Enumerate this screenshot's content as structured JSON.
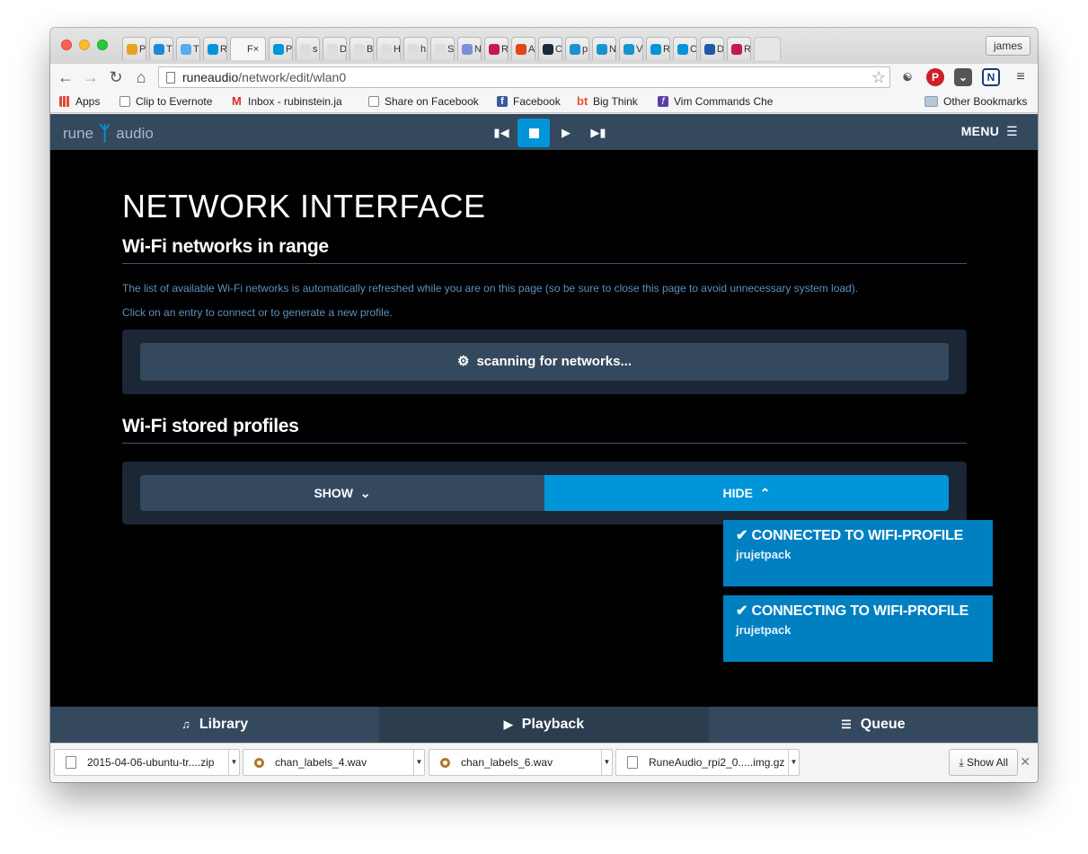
{
  "browser": {
    "profile_name": "james",
    "url_domain": "runeaudio",
    "url_path": "/network/edit/wlan0",
    "tabs": [
      {
        "label": "P",
        "icon": "yellow-face-icon",
        "color": "#e8a31e"
      },
      {
        "label": "T",
        "icon": "blue-play-icon",
        "color": "#1c8adb"
      },
      {
        "label": "T",
        "icon": "twitter-icon",
        "color": "#55acee"
      },
      {
        "label": "R",
        "icon": "rune-icon",
        "color": "#0095d8"
      },
      {
        "label": "F",
        "icon": "page-icon",
        "color": "#f6f6f6",
        "active": true
      },
      {
        "label": "P",
        "icon": "rune-icon",
        "color": "#0095d8"
      },
      {
        "label": "s",
        "icon": "page-icon",
        "color": "#dddddd"
      },
      {
        "label": "D",
        "icon": "page-icon",
        "color": "#dddddd"
      },
      {
        "label": "B",
        "icon": "page-icon",
        "color": "#dddddd"
      },
      {
        "label": "H",
        "icon": "page-icon",
        "color": "#dddddd"
      },
      {
        "label": "h",
        "icon": "page-icon",
        "color": "#dddddd"
      },
      {
        "label": "S",
        "icon": "page-icon",
        "color": "#dddddd"
      },
      {
        "label": "N",
        "icon": "target-icon",
        "color": "#7a8fd6"
      },
      {
        "label": "R",
        "icon": "raspberry-icon",
        "color": "#c51a4a"
      },
      {
        "label": "A",
        "icon": "ubuntu-icon",
        "color": "#dd4814"
      },
      {
        "label": "C",
        "icon": "dark-circle-icon",
        "color": "#1d2a3a"
      },
      {
        "label": "p",
        "icon": "arch-icon",
        "color": "#1793d1"
      },
      {
        "label": "N",
        "icon": "arch-icon",
        "color": "#1793d1"
      },
      {
        "label": "V",
        "icon": "arch-icon",
        "color": "#1793d1"
      },
      {
        "label": "R",
        "icon": "rune-icon",
        "color": "#0095d8"
      },
      {
        "label": "C",
        "icon": "rune-icon",
        "color": "#0095d8"
      },
      {
        "label": "D",
        "icon": "dnf-icon",
        "color": "#1e5aa8"
      },
      {
        "label": "R",
        "icon": "raspberry-icon",
        "color": "#c51a4a"
      }
    ],
    "bookmarks": [
      {
        "label": "Apps",
        "icon": "apps-grid-icon",
        "color": "#e04a3a"
      },
      {
        "label": "Clip to Evernote",
        "icon": "page-icon",
        "color": "#ffffff"
      },
      {
        "label": "Inbox - rubinstein.ja",
        "icon": "gmail-icon",
        "color": "#d93025"
      },
      {
        "label": "Share on Facebook",
        "icon": "page-icon",
        "color": "#ffffff"
      },
      {
        "label": "Facebook",
        "icon": "facebook-icon",
        "color": "#3b5998"
      },
      {
        "label": "Big Think",
        "icon": "bigthink-icon",
        "color": "#e8542b"
      },
      {
        "label": "Vim Commands Che",
        "icon": "vim-icon",
        "color": "#5a3ea8"
      }
    ],
    "other_bookmarks": "Other Bookmarks",
    "downloads": [
      {
        "name": "2015-04-06-ubuntu-tr....zip",
        "icon": "file-icon"
      },
      {
        "name": "chan_labels_4.wav",
        "icon": "audio-file-icon"
      },
      {
        "name": "chan_labels_6.wav",
        "icon": "audio-file-icon"
      },
      {
        "name": "RuneAudio_rpi2_0.....img.gz",
        "icon": "file-icon"
      }
    ],
    "show_all": "Show All"
  },
  "app": {
    "logo_left": "rune",
    "logo_right": "audio",
    "menu_label": "MENU",
    "page_title": "NETWORK INTERFACE",
    "section_wifi": "Wi-Fi networks in range",
    "help_refresh": "The list of available Wi-Fi networks is automatically refreshed while you are on this page (so be sure to close this page to avoid unnecessary system load).",
    "help_click": "Click on an entry to connect or to generate a new profile.",
    "scanning": "scanning for networks...",
    "section_profiles": "Wi-Fi stored profiles",
    "show_label": "SHOW",
    "hide_label": "HIDE",
    "notices": [
      {
        "title": "CONNECTED TO WIFI-PROFILE",
        "body": "jrujetpack"
      },
      {
        "title": "CONNECTING TO WIFI-PROFILE",
        "body": "jrujetpack"
      }
    ],
    "bottom_tabs": [
      {
        "label": "Library",
        "icon": "music-note-icon"
      },
      {
        "label": "Playback",
        "icon": "play-icon",
        "active": true
      },
      {
        "label": "Queue",
        "icon": "list-icon"
      }
    ],
    "colors": {
      "accent": "#0095d8",
      "bar": "#34495e",
      "help_text": "#5f8fbd"
    }
  }
}
